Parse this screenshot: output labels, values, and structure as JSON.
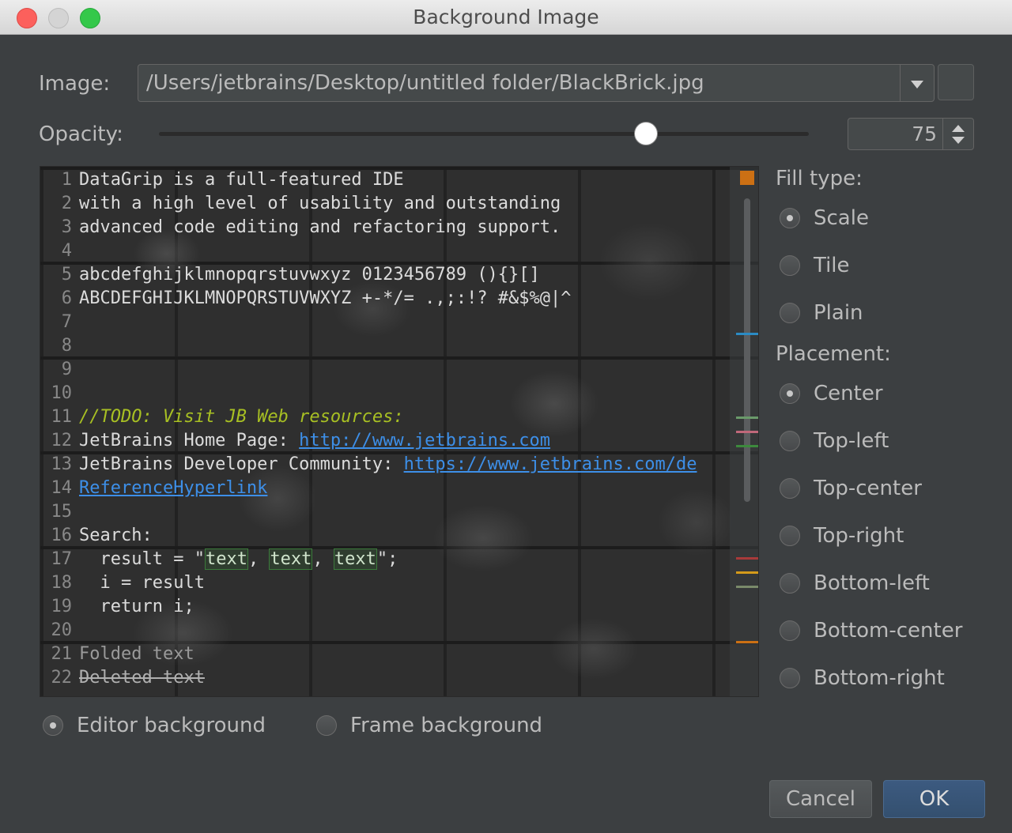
{
  "window": {
    "title": "Background Image"
  },
  "image": {
    "label": "Image:",
    "path": "/Users/jetbrains/Desktop/untitled folder/BlackBrick.jpg"
  },
  "opacity": {
    "label": "Opacity:",
    "value": "75",
    "slider_fraction": 0.75
  },
  "fill_type": {
    "title": "Fill type:",
    "options": [
      "Scale",
      "Tile",
      "Plain"
    ],
    "selected": "Scale"
  },
  "placement": {
    "title": "Placement:",
    "options": [
      "Center",
      "Top-left",
      "Top-center",
      "Top-right",
      "Bottom-left",
      "Bottom-center",
      "Bottom-right"
    ],
    "selected": "Center"
  },
  "target": {
    "options": [
      "Editor background",
      "Frame background"
    ],
    "selected": "Editor background"
  },
  "buttons": {
    "cancel": "Cancel",
    "ok": "OK"
  },
  "preview": {
    "lines": [
      {
        "n": "1",
        "text": "DataGrip is a full-featured IDE"
      },
      {
        "n": "2",
        "text": "with a high level of usability and outstanding"
      },
      {
        "n": "3",
        "text": "advanced code editing and refactoring support."
      },
      {
        "n": "4",
        "text": ""
      },
      {
        "n": "5",
        "text": "abcdefghijklmnopqrstuvwxyz 0123456789 (){}[]"
      },
      {
        "n": "6",
        "text": "ABCDEFGHIJKLMNOPQRSTUVWXYZ +-*/= .,;:!? #&$%@|^"
      },
      {
        "n": "7",
        "text": ""
      },
      {
        "n": "8",
        "text": ""
      },
      {
        "n": "9",
        "text": ""
      },
      {
        "n": "10",
        "text": ""
      },
      {
        "n": "11",
        "text": "//TODO: Visit JB Web resources:"
      },
      {
        "n": "12",
        "text": "JetBrains Home Page: ",
        "link": "http://www.jetbrains.com"
      },
      {
        "n": "13",
        "text": "JetBrains Developer Community: ",
        "link": "https://www.jetbrains.com/de"
      },
      {
        "n": "14",
        "text": "",
        "link": "ReferenceHyperlink"
      },
      {
        "n": "15",
        "text": ""
      },
      {
        "n": "16",
        "text": "Search:"
      },
      {
        "n": "17",
        "text": "result = \"text, text, text\";"
      },
      {
        "n": "18",
        "text": "i = result"
      },
      {
        "n": "19",
        "text": "return i;"
      },
      {
        "n": "20",
        "text": ""
      },
      {
        "n": "21",
        "text": "Folded text"
      },
      {
        "n": "22",
        "text": "Deleted text"
      }
    ],
    "marker_colors": [
      "#cc7014",
      "#2b8bc4",
      "#6a9a6a",
      "#c0687a",
      "#3d8a3d",
      "#a83a3a",
      "#d49a1a",
      "#7a8a6a",
      "#cc7014"
    ]
  }
}
